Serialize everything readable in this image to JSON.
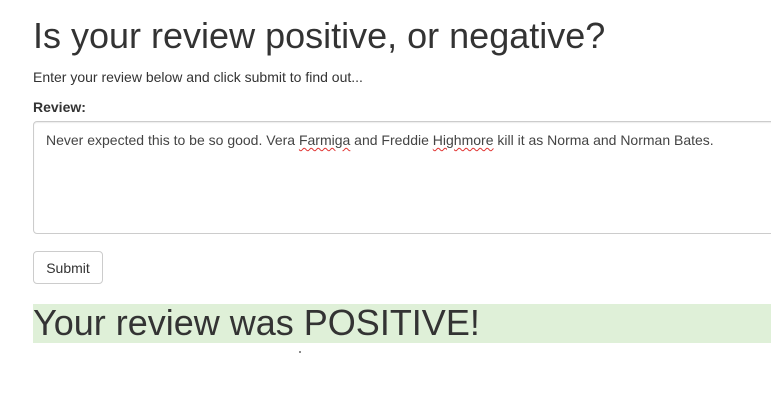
{
  "page": {
    "title": "Is your review positive, or negative?",
    "intro": "Enter your review below and click submit to find out..."
  },
  "form": {
    "review_label": "Review:",
    "review_text": {
      "part1": "Never expected this to be so good. Vera ",
      "word1": "Farmiga",
      "part2": " and Freddie ",
      "word2": "Highmore",
      "part3": " kill it as Norma and Norman Bates."
    },
    "submit_label": "Submit"
  },
  "result": {
    "text": "Your review was POSITIVE!",
    "status_color": "#dff0d8"
  }
}
